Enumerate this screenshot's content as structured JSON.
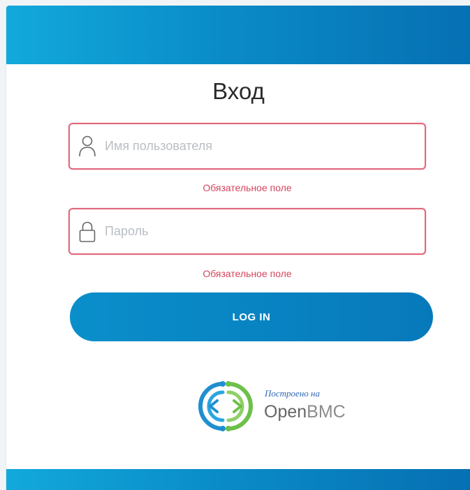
{
  "header": {
    "accent_color": "#0a8cc8"
  },
  "login": {
    "title": "Вход",
    "username": {
      "placeholder": "Имя пользователя",
      "value": "",
      "error": "Обязательное поле",
      "icon": "user-icon"
    },
    "password": {
      "placeholder": "Пароль",
      "value": "",
      "error": "Обязательное поле",
      "icon": "lock-icon"
    },
    "submit_label": "LOG IN",
    "error_color": "#d6455e"
  },
  "footer_logo": {
    "built_on": "Построено на",
    "brand_open": "Open",
    "brand_bmc": "BMC",
    "icon": "openbmc-logo-icon"
  }
}
